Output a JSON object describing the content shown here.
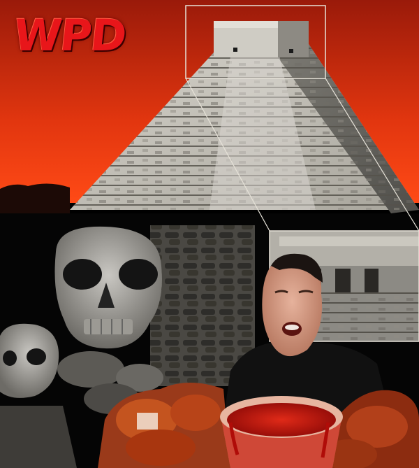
{
  "logo": {
    "text": "WPD"
  },
  "colors": {
    "sky_top": "#9a1a0a",
    "sky_bottom": "#ff4a16",
    "logo_red": "#e8161a",
    "sauce_red": "#c8120c",
    "stone_grey": "#b9b6ad"
  },
  "elements": [
    "red-sky",
    "pyramid",
    "zoom-inset-frame",
    "inset-temple-photo",
    "skull-large",
    "skull-small",
    "stone-wall",
    "man-eating",
    "fried-chicken-pile",
    "sauce-bucket"
  ]
}
